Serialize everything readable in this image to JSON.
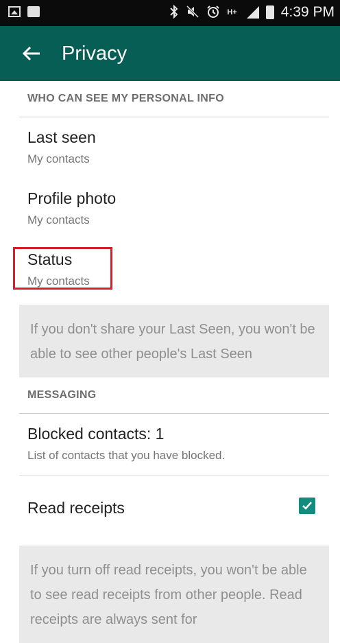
{
  "status_bar": {
    "time": "4:39 PM",
    "icons": [
      "image-icon",
      "briefcase-icon",
      "bluetooth-icon",
      "mute-icon",
      "alarm-icon",
      "network-icon",
      "signal-icon",
      "battery-icon"
    ],
    "network_label": "H+"
  },
  "app_bar": {
    "title": "Privacy",
    "background_color": "#075e54"
  },
  "personal_info": {
    "header": "WHO CAN SEE MY PERSONAL INFO",
    "items": [
      {
        "title": "Last seen",
        "summary": "My contacts"
      },
      {
        "title": "Profile photo",
        "summary": "My contacts"
      },
      {
        "title": "Status",
        "summary": "My contacts"
      }
    ],
    "info": "If you don't share your Last Seen, you won't be able to see other people's Last Seen"
  },
  "messaging": {
    "header": "MESSAGING",
    "blocked": {
      "title": "Blocked contacts: 1",
      "summary": "List of contacts that you have blocked."
    },
    "read_receipts": {
      "title": "Read receipts",
      "checked": true
    },
    "info": "If you turn off read receipts, you won't be able to see read receipts from other people. Read receipts are always sent for"
  },
  "highlight_color": "#d32027",
  "accent_color": "#128c7e"
}
